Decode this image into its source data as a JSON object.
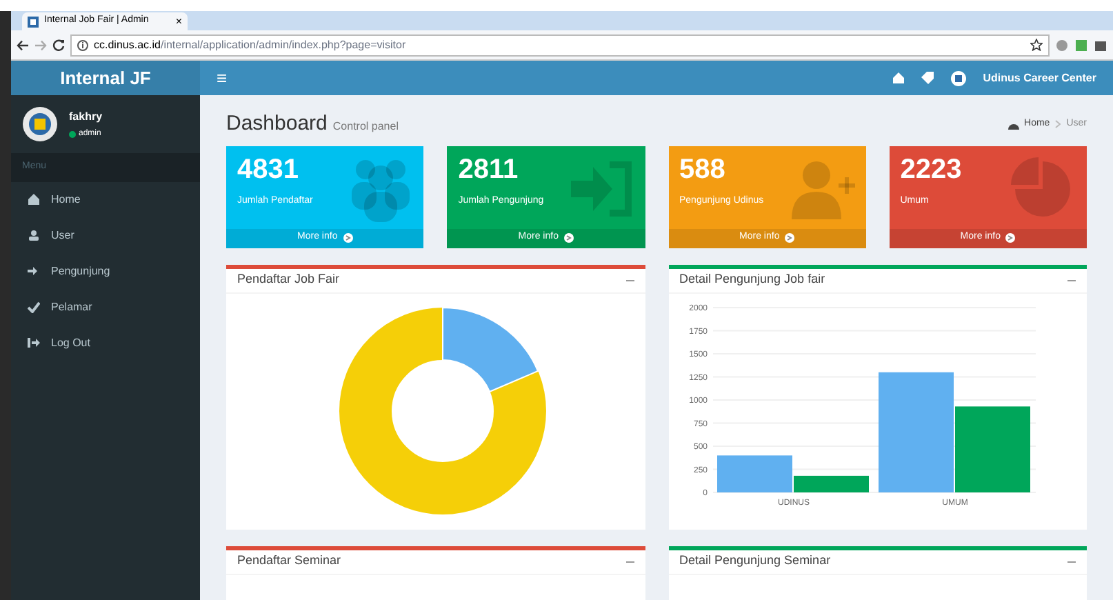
{
  "browser": {
    "tab_title": "Internal Job Fair | Admin",
    "tab_close": "×",
    "url_host": "cc.dinus.ac.id",
    "url_path": "/internal/application/admin/index.php?page=visitor"
  },
  "header": {
    "brand": "Internal JF",
    "menu_toggle": "≡",
    "org": "Udinus Career Center"
  },
  "user": {
    "name": "fakhry",
    "role": "admin"
  },
  "sidebar": {
    "heading": "Menu",
    "items": [
      {
        "label": "Home",
        "kind": "home"
      },
      {
        "label": "User",
        "kind": "users"
      },
      {
        "label": "Pengunjung",
        "kind": "signin"
      },
      {
        "label": "Pelamar",
        "kind": "check"
      },
      {
        "label": "Log Out",
        "kind": "logout"
      }
    ]
  },
  "page": {
    "title": "Dashboard",
    "subtitle": "Control panel",
    "breadcrumb": [
      "Home",
      "User"
    ]
  },
  "stats": [
    {
      "value": "4831",
      "label": "Jumlah Pendaftar",
      "link": "More info",
      "color": "#00c0ef",
      "kind": "users"
    },
    {
      "value": "2811",
      "label": "Jumlah Pengunjung",
      "link": "More info",
      "color": "#00a65a",
      "kind": "signin"
    },
    {
      "value": "588",
      "label": "Pengunjung Udinus",
      "link": "More info",
      "color": "#f39c12",
      "kind": "useradd"
    },
    {
      "value": "2223",
      "label": "Umum",
      "link": "More info",
      "color": "#dd4b39",
      "kind": "pie"
    }
  ],
  "panels": [
    {
      "title": "Pendaftar Job Fair",
      "color": "#dd4b39",
      "kind": "donut"
    },
    {
      "title": "Detail Pengunjung Job fair",
      "color": "#00a65a",
      "kind": "bar",
      "chart_data": {
        "type": "bar",
        "categories": [
          "UDINUS",
          "UMUM"
        ],
        "series": [
          {
            "color": "#60b0f0",
            "values": [
              400,
              1300
            ]
          },
          {
            "color": "#00a65a",
            "values": [
              180,
              930
            ]
          }
        ],
        "grid": true,
        "ylim": [
          0,
          2000
        ],
        "yticks": [
          0,
          250,
          500,
          750,
          1000,
          1250,
          1500,
          1750,
          2000
        ]
      }
    },
    {
      "title": "Pendaftar Seminar",
      "color": "#dd4b39",
      "kind": "empty"
    },
    {
      "title": "Detail Pengunjung Seminar",
      "color": "#00a65a",
      "kind": "empty"
    }
  ]
}
